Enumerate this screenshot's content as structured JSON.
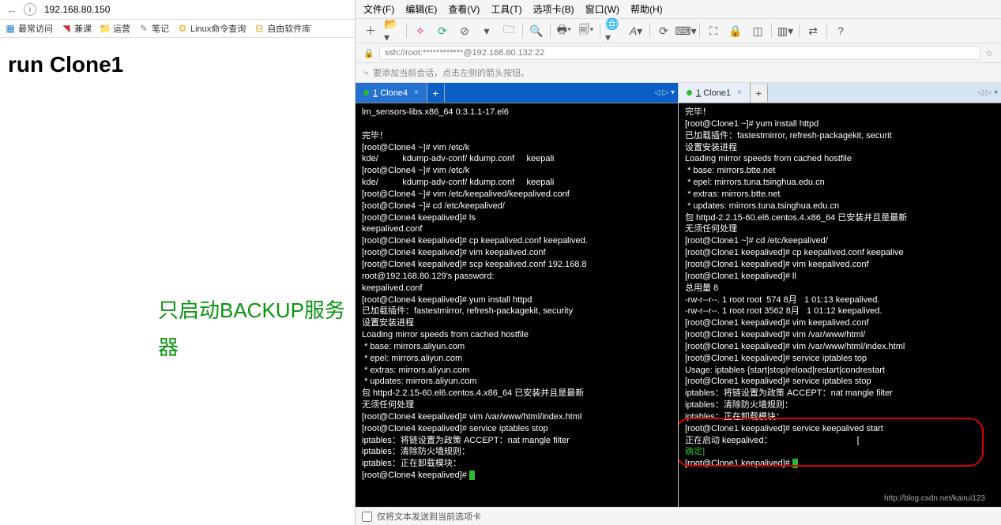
{
  "browser": {
    "url": "192.168.80.150",
    "bookmarks": [
      "最常访问",
      "兼课",
      "运营",
      "笔记",
      "Linux命令查询",
      "自由软件库"
    ],
    "page_title": "run Clone1",
    "overlay_text": "只启动BACKUP服务器"
  },
  "editor": {
    "menus": [
      "文件(F)",
      "编辑(E)",
      "查看(V)",
      "工具(T)",
      "选项卡(B)",
      "窗口(W)",
      "帮助(H)"
    ],
    "address": "ssh://root:************@192.168.80.132:22",
    "hint": "要添加当前会话，点击左侧的箭头按钮。",
    "status_text": "仅将文本发送到当前选项卡"
  },
  "left_pane": {
    "tab_num": "1",
    "tab_label": "Clone4",
    "lines": [
      "lm_sensors-libs.x86_64 0:3.1.1-17.el6",
      "",
      "完毕！",
      "[root@Clone4 ~]# vim /etc/k",
      "kde/          kdump-adv-conf/ kdump.conf     keepali",
      "[root@Clone4 ~]# vim /etc/k",
      "kde/          kdump-adv-conf/ kdump.conf     keepali",
      "[root@Clone4 ~]# vim /etc/keepalived/keepalived.conf",
      "[root@Clone4 ~]# cd /etc/keepalived/",
      "[root@Clone4 keepalived]# ls",
      "keepalived.conf",
      "[root@Clone4 keepalived]# cp keepalived.conf keepalived.",
      "[root@Clone4 keepalived]# vim keepalived.conf",
      "[root@Clone4 keepalived]# scp keepalived.conf 192.168.8",
      "root@192.168.80.129's password:",
      "keepalived.conf",
      "[root@Clone4 keepalived]# yum install httpd",
      "已加载插件：fastestmirror, refresh-packagekit, security",
      "设置安装进程",
      "Loading mirror speeds from cached hostfile",
      " * base: mirrors.aliyun.com",
      " * epel: mirrors.aliyun.com",
      " * extras: mirrors.aliyun.com",
      " * updates: mirrors.aliyun.com",
      "包 httpd-2.2.15-60.el6.centos.4.x86_64 已安装并且是最新",
      "无须任何处理",
      "[root@Clone4 keepalived]# vim /var/www/html/index.html",
      "[root@Clone4 keepalived]# service iptables stop",
      "iptables：将链设置为政策 ACCEPT：nat mangle filter",
      "iptables：清除防火墙规则：",
      "iptables：正在卸载模块：",
      "[root@Clone4 keepalived]# "
    ]
  },
  "right_pane": {
    "tab_num": "1",
    "tab_label": "Clone1",
    "lines": [
      "完毕！",
      "[root@Clone1 ~]# yum install httpd",
      "已加载插件：fastestmirror, refresh-packagekit, securit",
      "设置安装进程",
      "Loading mirror speeds from cached hostfile",
      " * base: mirrors.btte.net",
      " * epel: mirrors.tuna.tsinghua.edu.cn",
      " * extras: mirrors.btte.net",
      " * updates: mirrors.tuna.tsinghua.edu.cn",
      "包 httpd-2.2.15-60.el6.centos.4.x86_64 已安装并且是最新",
      "无须任何处理",
      "[root@Clone1 ~]# cd /etc/keepalived/",
      "[root@Clone1 keepalived]# cp keepalived.conf keepalive",
      "[root@Clone1 keepalived]# vim keepalived.conf",
      "[root@Clone1 keepalived]# ll",
      "总用量 8",
      "-rw-r--r--. 1 root root  574 8月   1 01:13 keepalived.",
      "-rw-r--r--. 1 root root 3562 8月   1 01:12 keepalived.",
      "[root@Clone1 keepalived]# vim keepalived.conf",
      "[root@Clone1 keepalived]# vim /var/www/html/",
      "[root@Clone1 keepalived]# vim /var/www/html/index.html",
      "[root@Clone1 keepalived]# service iptables top",
      "Usage: iptables {start|stop|reload|restart|condrestart",
      "[root@Clone1 keepalived]# service iptables stop",
      "iptables：将链设置为政策 ACCEPT：nat mangle filter",
      "iptables：清除防火墙规则：",
      "iptables：正在卸载模块：",
      "[root@Clone1 keepalived]# service keepalived start",
      "正在启动 keepalived：                                   [",
      "确定]",
      "[root@Clone1 keepalived]# "
    ]
  },
  "watermark": "http://blog.csdn.net/kairui123"
}
